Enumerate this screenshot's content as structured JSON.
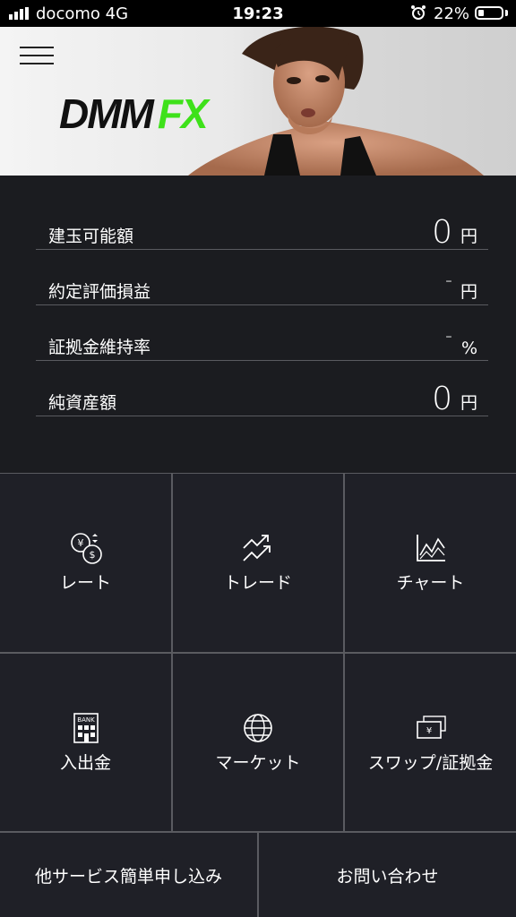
{
  "status_bar": {
    "carrier": "docomo  4G",
    "time": "19:23",
    "battery": "22%"
  },
  "banner": {
    "logo_dmm": "DMM",
    "logo_fx": "FX"
  },
  "account": {
    "rows": [
      {
        "label": "建玉可能額",
        "value": "0",
        "unit": "円"
      },
      {
        "label": "約定評価損益",
        "value": "-",
        "unit": "円"
      },
      {
        "label": "証拠金維持率",
        "value": "-",
        "unit": "%"
      },
      {
        "label": "純資産額",
        "value": "0",
        "unit": "円"
      }
    ]
  },
  "menu": {
    "items": [
      {
        "label": "レート",
        "icon": "yen-dollar-exchange-icon"
      },
      {
        "label": "トレード",
        "icon": "trade-arrows-icon"
      },
      {
        "label": "チャート",
        "icon": "chart-icon"
      },
      {
        "label": "入出金",
        "icon": "bank-icon"
      },
      {
        "label": "マーケット",
        "icon": "globe-icon"
      },
      {
        "label": "スワップ/証拠金",
        "icon": "yen-banknote-icon"
      }
    ],
    "bottom": [
      {
        "label": "他サービス簡単申し込み"
      },
      {
        "label": "お問い合わせ"
      }
    ]
  }
}
